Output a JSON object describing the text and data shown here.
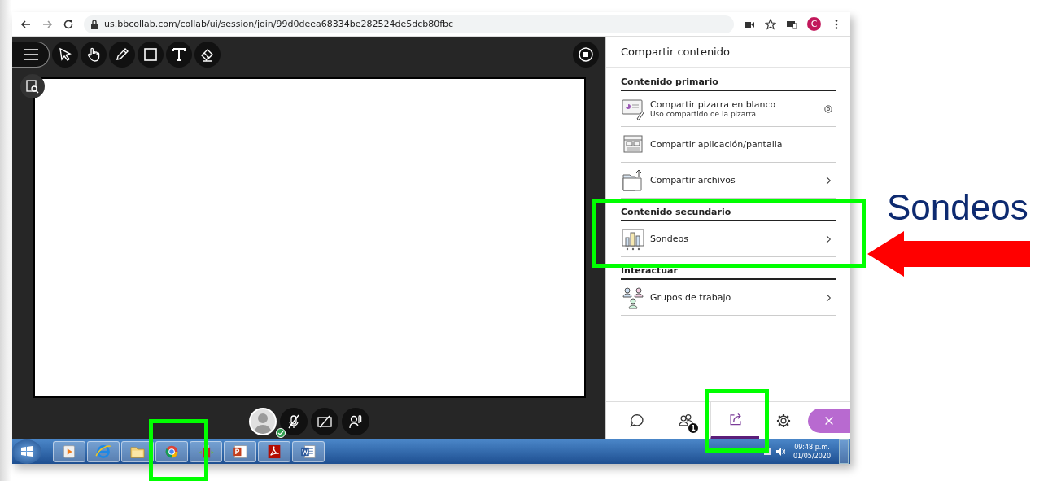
{
  "browser": {
    "url": "us.bbcollab.com/collab/ui/session/join/99d0deea68334be282524de5dcb80fbc",
    "profile_initial": "C"
  },
  "panel": {
    "title": "Compartir contenido",
    "sections": [
      {
        "heading": "Contenido primario",
        "items": [
          {
            "kind": "whiteboard",
            "label": "Compartir pizarra en blanco",
            "sublabel": "Uso compartido de la pizarra",
            "chevron": false,
            "stop_button": true
          },
          {
            "kind": "screen",
            "label": "Compartir aplicación/pantalla",
            "chevron": false,
            "stop_button": false
          },
          {
            "kind": "files",
            "label": "Compartir archivos",
            "chevron": true,
            "stop_button": false
          }
        ]
      },
      {
        "heading": "Contenido secundario",
        "items": [
          {
            "kind": "polls",
            "label": "Sondeos",
            "chevron": true,
            "stop_button": false
          }
        ]
      },
      {
        "heading": "Interactuar",
        "items": [
          {
            "kind": "groups",
            "label": "Grupos de trabajo",
            "chevron": true,
            "stop_button": false
          }
        ]
      }
    ],
    "tabs": [
      {
        "kind": "chat",
        "selected": false
      },
      {
        "kind": "attendees",
        "selected": false,
        "badge": "1"
      },
      {
        "kind": "share",
        "selected": true
      },
      {
        "kind": "settings",
        "selected": false
      },
      {
        "kind": "close",
        "selected": false
      }
    ]
  },
  "taskbar": {
    "apps": [
      {
        "kind": "media"
      },
      {
        "kind": "ie"
      },
      {
        "kind": "folder"
      },
      {
        "kind": "chrome"
      },
      {
        "kind": "usb"
      },
      {
        "kind": "ppt"
      },
      {
        "kind": "pdf"
      },
      {
        "kind": "word"
      }
    ],
    "time": "09:48 p.m.",
    "date": "01/05/2020"
  },
  "annotation": {
    "callout": "Sondeos"
  }
}
